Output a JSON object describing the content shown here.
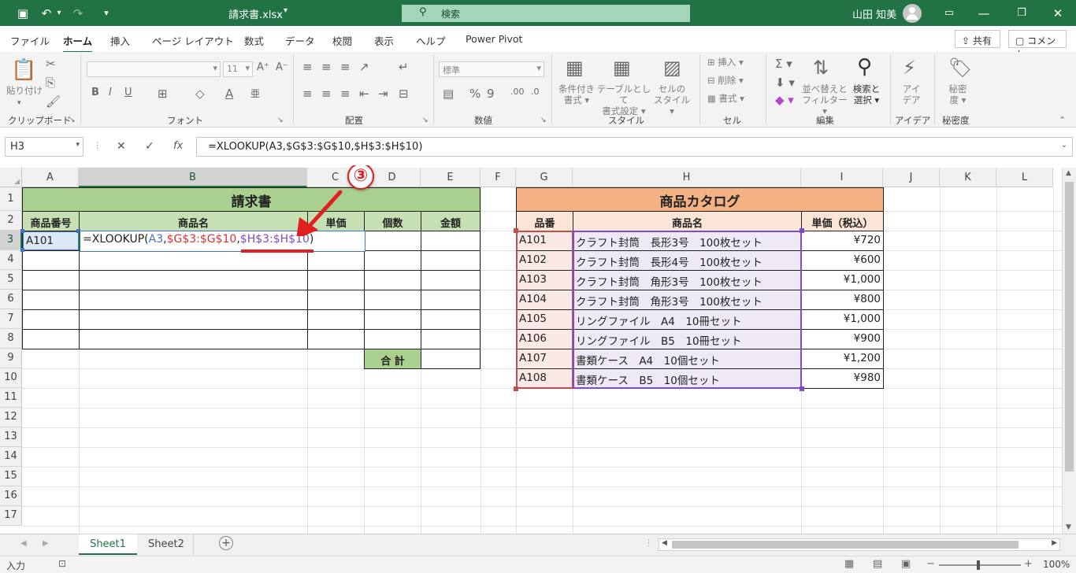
{
  "titlebar": {
    "filename": "請求書.xlsx",
    "search_placeholder": "検索",
    "username": "山田 知美",
    "bg": "#217346"
  },
  "menu": [
    {
      "label": "ファイル",
      "active": false
    },
    {
      "label": "ホーム",
      "active": true
    },
    {
      "label": "挿入",
      "active": false
    },
    {
      "label": "ページ レイアウト",
      "active": false
    },
    {
      "label": "数式",
      "active": false
    },
    {
      "label": "データ",
      "active": false
    },
    {
      "label": "校閲",
      "active": false
    },
    {
      "label": "表示",
      "active": false
    },
    {
      "label": "ヘルプ",
      "active": false
    },
    {
      "label": "Power Pivot",
      "active": false
    }
  ],
  "topbuttons": {
    "share": "共有",
    "comment": "コメント"
  },
  "ribbon": {
    "clipboard": {
      "label": "クリップボード",
      "paste": "貼り付け"
    },
    "font": {
      "label": "フォント",
      "size": "11"
    },
    "alignment": {
      "label": "配置"
    },
    "number": {
      "label": "数値",
      "format": "標準"
    },
    "styles": {
      "label": "スタイル",
      "cond1": "条件付き",
      "cond2": "書式",
      "table1": "テーブルとして",
      "table2": "書式設定",
      "cell1": "セルの",
      "cell2": "スタイル"
    },
    "cells": {
      "label": "セル",
      "insert": "挿入",
      "delete": "削除",
      "format": "書式"
    },
    "editing": {
      "label": "編集",
      "sort1": "並べ替えと",
      "sort2": "フィルター",
      "find1": "検索と",
      "find2": "選択"
    },
    "ideas": {
      "label": "アイデア",
      "btn1": "アイ",
      "btn2": "デア"
    },
    "sensitivity": {
      "label": "秘密度",
      "btn1": "秘密",
      "btn2": "度"
    }
  },
  "formula_bar": {
    "namebox": "H3",
    "fx": "fx",
    "formula": "=XLOOKUP(A3,$G$3:$G$10,$H$3:$H$10)"
  },
  "columns": [
    "A",
    "B",
    "C",
    "D",
    "E",
    "F",
    "G",
    "H",
    "I",
    "J",
    "K",
    "L"
  ],
  "rows": [
    "1",
    "2",
    "3",
    "4",
    "5",
    "6",
    "7",
    "8",
    "9",
    "10",
    "11",
    "12",
    "13",
    "14",
    "15",
    "16",
    "17"
  ],
  "invoice": {
    "title": "請求書",
    "headers": [
      "商品番号",
      "商品名",
      "単価",
      "個数",
      "金額"
    ],
    "a3": "A101",
    "editing": {
      "p1": "=XLOOKUP(",
      "p2": "A3",
      "p3": ",",
      "p4": "$G$3:$G$10",
      "p5": ",",
      "p6": "$H$3:$H$10",
      "p7": ")"
    },
    "total_label": "合 計"
  },
  "annotation": {
    "number": "③"
  },
  "catalog": {
    "title": "商品カタログ",
    "headers": [
      "品番",
      "商品名",
      "単価（税込）"
    ],
    "rows": [
      {
        "code": "A101",
        "name": "クラフト封筒　長形3号　100枚セット",
        "price": "¥720"
      },
      {
        "code": "A102",
        "name": "クラフト封筒　長形4号　100枚セット",
        "price": "¥600"
      },
      {
        "code": "A103",
        "name": "クラフト封筒　角形3号　100枚セット",
        "price": "¥1,000"
      },
      {
        "code": "A104",
        "name": "クラフト封筒　角形3号　100枚セット",
        "price": "¥800"
      },
      {
        "code": "A105",
        "name": "リングファイル　A4　10冊セット",
        "price": "¥1,000"
      },
      {
        "code": "A106",
        "name": "リングファイル　B5　10冊セット",
        "price": "¥900"
      },
      {
        "code": "A107",
        "name": "書類ケース　A4　10個セット",
        "price": "¥1,200"
      },
      {
        "code": "A108",
        "name": "書類ケース　B5　10個セット",
        "price": "¥980"
      }
    ]
  },
  "sheets": [
    "Sheet1",
    "Sheet2"
  ],
  "status": {
    "mode": "入力",
    "zoom": "100%"
  },
  "colors": {
    "green_header": "#a9d08e",
    "green_sub": "#c6e0b4",
    "orange_header": "#f4b183",
    "orange_sub": "#fbe5d6",
    "range_red": "#c0504d",
    "range_purple": "#7e4cc4"
  }
}
